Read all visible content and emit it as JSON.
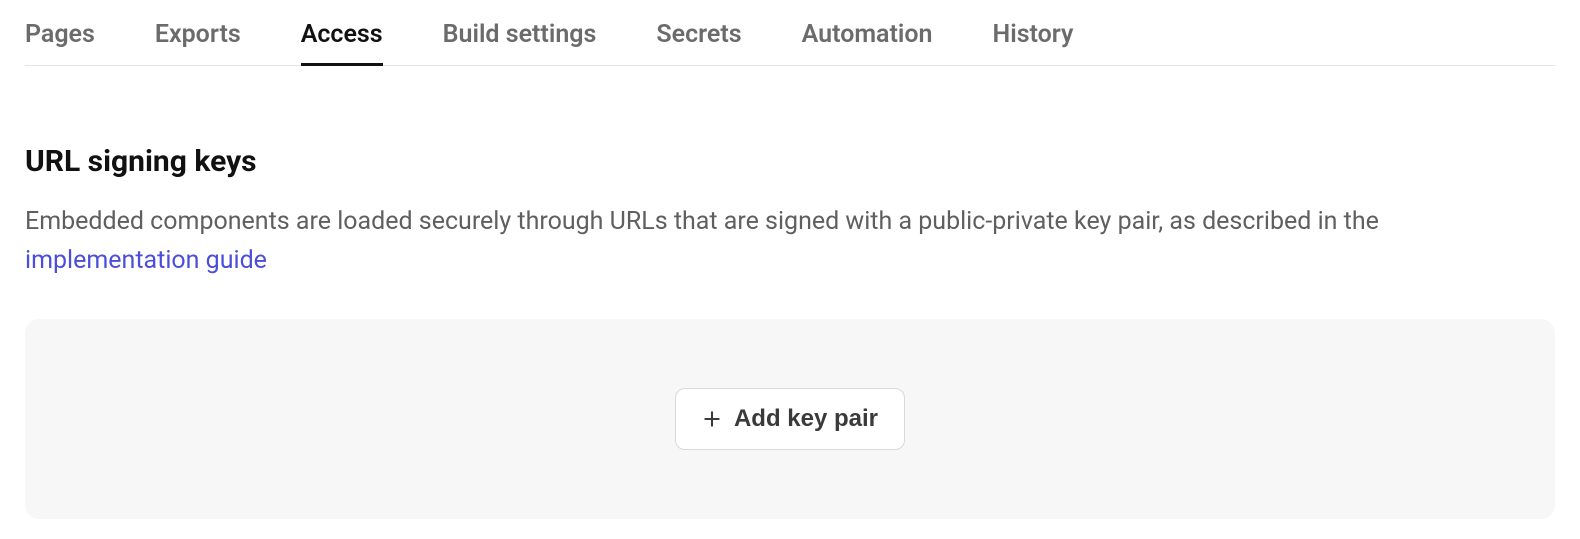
{
  "tabs": [
    {
      "label": "Pages",
      "active": false
    },
    {
      "label": "Exports",
      "active": false
    },
    {
      "label": "Access",
      "active": true
    },
    {
      "label": "Build settings",
      "active": false
    },
    {
      "label": "Secrets",
      "active": false
    },
    {
      "label": "Automation",
      "active": false
    },
    {
      "label": "History",
      "active": false
    }
  ],
  "section": {
    "title": "URL signing keys",
    "description_pre": "Embedded components are loaded securely through URLs that are signed with a public-private key pair, as described in the ",
    "link_text": "implementation guide"
  },
  "actions": {
    "add_key_pair_label": "Add key pair"
  }
}
